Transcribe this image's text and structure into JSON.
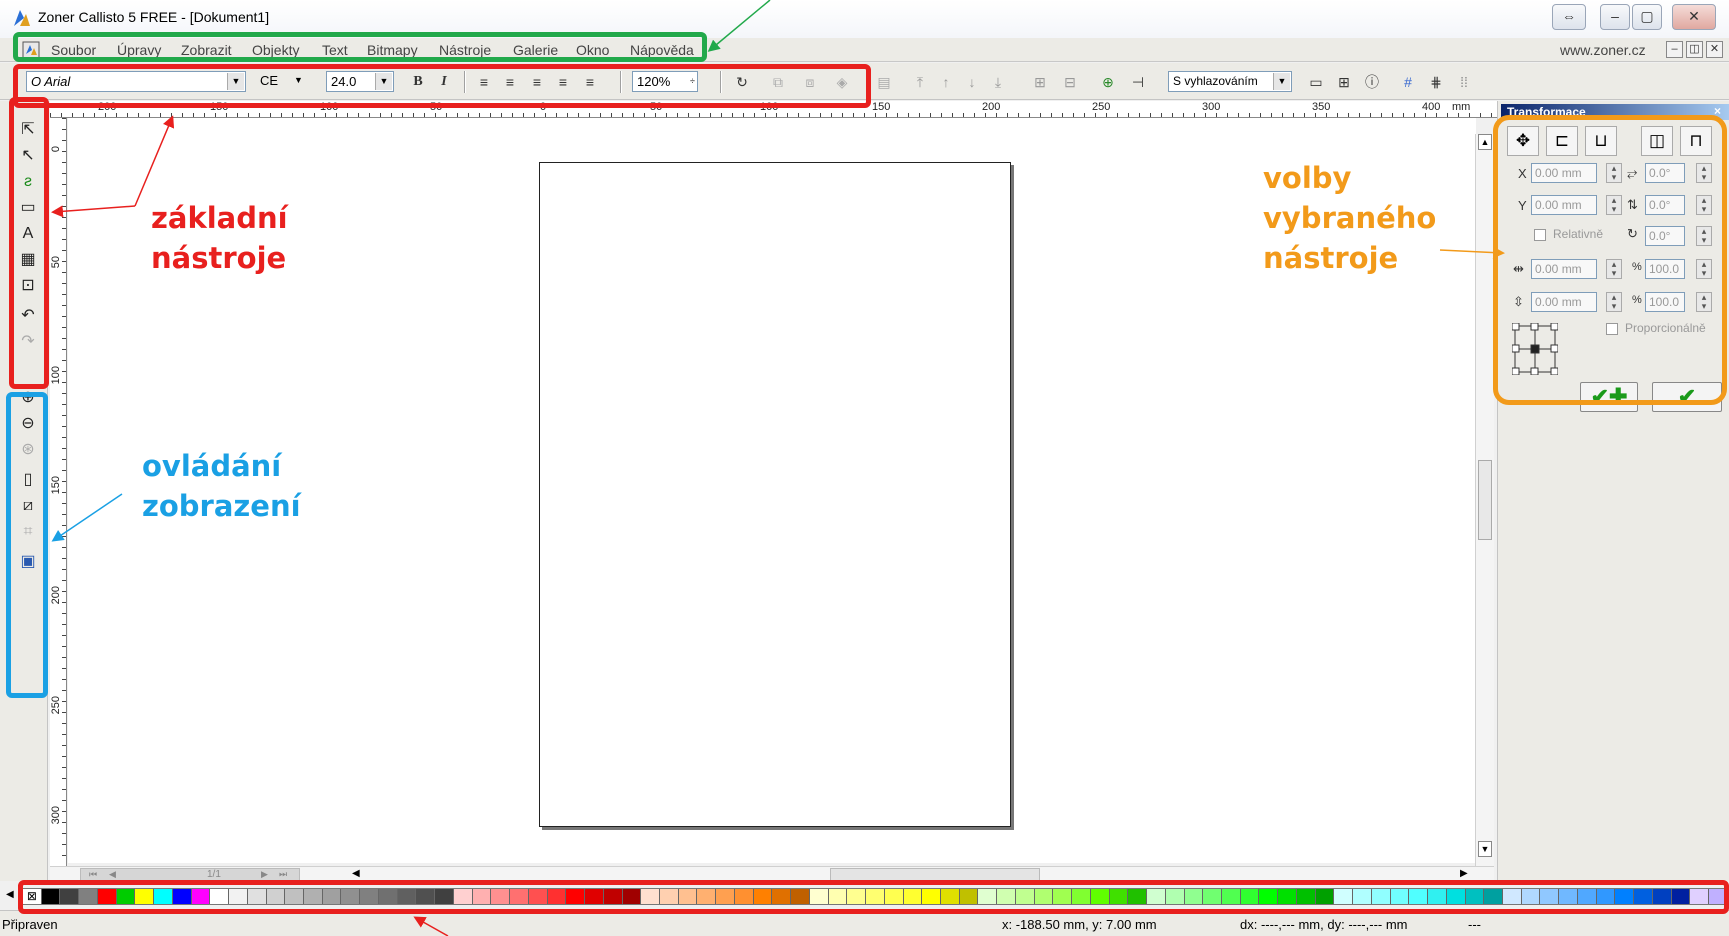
{
  "window": {
    "title": "Zoner Callisto 5 FREE - [Dokument1]"
  },
  "menu": {
    "items": [
      "Soubor",
      "Úpravy",
      "Zobrazit",
      "Objekty",
      "Text",
      "Bitmapy",
      "Nástroje",
      "Galerie",
      "Okno",
      "Nápověda"
    ],
    "link": "www.zoner.cz"
  },
  "toolbar": {
    "font": "O Arial",
    "encoding": "CE",
    "size": "24.0",
    "bold": "B",
    "italic": "I",
    "zoom": "120%",
    "smoothing": "S vyhlazováním"
  },
  "ruler": {
    "unit": "mm",
    "h_labels": [
      "200",
      "150",
      "100",
      "50",
      "0",
      "50",
      "100",
      "150",
      "200",
      "250",
      "300",
      "350",
      "400"
    ],
    "v_labels": [
      "0",
      "50",
      "100",
      "150",
      "200",
      "250",
      "300"
    ]
  },
  "page_nav": {
    "label": "1/1"
  },
  "transform_panel": {
    "title": "Transformace",
    "x_label": "X",
    "x_value": "0.00 mm",
    "y_label": "Y",
    "y_value": "0.00 mm",
    "rot1_value": "0.0°",
    "rot2_value": "0.0°",
    "rot3_value": "0.0°",
    "relative_label": "Relativně",
    "w_value": "0.00 mm",
    "h_value": "0.00 mm",
    "w_pct": "100.0",
    "h_pct": "100.0",
    "pct_sign": "%",
    "proportional_label": "Proporcionálně"
  },
  "status": {
    "ready": "Připraven",
    "coords": "x: -188.50 mm, y: 7.00 mm",
    "delta": "dx: ----,--- mm, dy: ----,--- mm",
    "extra": "---"
  },
  "annotations": {
    "basic_tools_line1": "základní",
    "basic_tools_line2": "nástroje",
    "view_control_line1": "ovládání",
    "view_control_line2": "zobrazení",
    "tool_options_line1": "volby",
    "tool_options_line2": "vybraného",
    "tool_options_line3": "nástroje"
  },
  "colors": {
    "red": "#e8201e",
    "blue": "#1aa0e4",
    "green": "#22a94b",
    "orange": "#f29a1a"
  },
  "palette": [
    "#ffffff",
    "#000000",
    "#404040",
    "#808080",
    "#ff0000",
    "#00cc00",
    "#ffff00",
    "#00ffff",
    "#0000ff",
    "#ff00ff",
    "#ffffff",
    "#f2f2f2",
    "#e0e0e0",
    "#d0d0d0",
    "#c0c0c0",
    "#b0b0b0",
    "#a0a0a0",
    "#909090",
    "#808080",
    "#707070",
    "#606060",
    "#505050",
    "#404040",
    "#ffd0d0",
    "#ffb0b0",
    "#ff9090",
    "#ff7070",
    "#ff5050",
    "#ff3030",
    "#ff0000",
    "#e00000",
    "#c00000",
    "#a00000",
    "#ffe0d0",
    "#ffd0b0",
    "#ffc090",
    "#ffb070",
    "#ffa050",
    "#ff9030",
    "#ff8000",
    "#e07000",
    "#c06000",
    "#ffffd0",
    "#ffffb0",
    "#ffff90",
    "#ffff70",
    "#ffff50",
    "#ffff30",
    "#ffff00",
    "#e0e000",
    "#c0c000",
    "#e0ffd0",
    "#d0ffb0",
    "#c0ff90",
    "#b0ff70",
    "#a0ff50",
    "#80ff30",
    "#60ff00",
    "#40e000",
    "#20c000",
    "#d0ffd0",
    "#b0ffb0",
    "#90ff90",
    "#70ff70",
    "#50ff50",
    "#30ff30",
    "#00ff00",
    "#00e000",
    "#00c000",
    "#00a000",
    "#d0ffff",
    "#b0ffff",
    "#90ffff",
    "#70ffff",
    "#50ffff",
    "#30f0f0",
    "#00e0e0",
    "#00c0c0",
    "#00a0a0",
    "#d0e8ff",
    "#b0d8ff",
    "#90c8ff",
    "#70b8ff",
    "#50a8ff",
    "#3098ff",
    "#0080ff",
    "#0060e0",
    "#0040c0",
    "#0020a0",
    "#e0d0ff",
    "#c0b0ff"
  ]
}
